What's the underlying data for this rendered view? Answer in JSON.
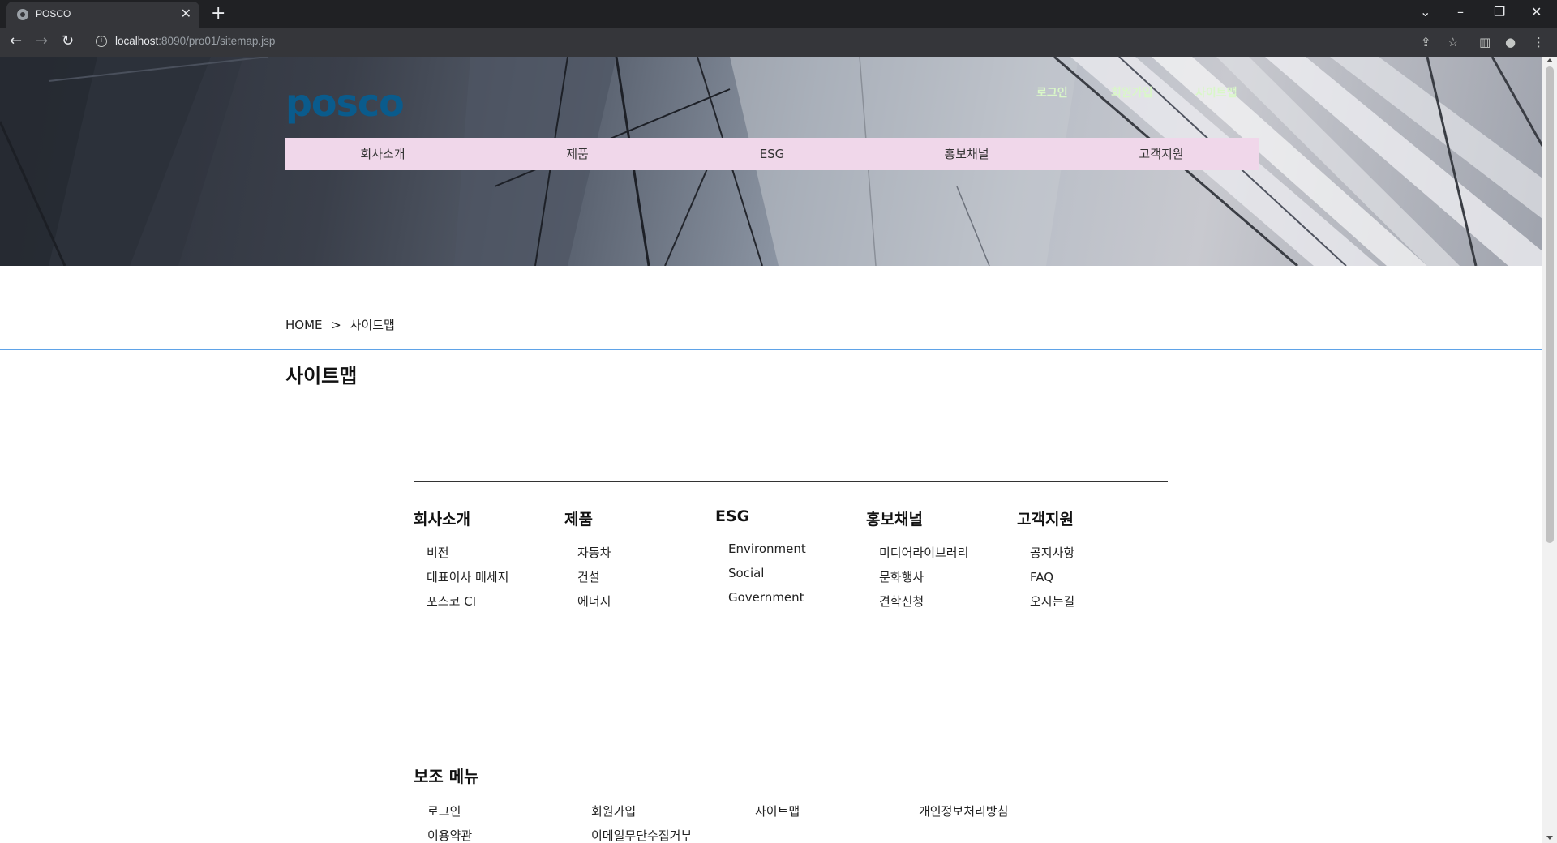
{
  "browser": {
    "tab_title": "POSCO",
    "url_host": "localhost",
    "url_path": ":8090/pro01/sitemap.jsp"
  },
  "header": {
    "logo_text": "posco",
    "util_links": [
      "로그인",
      "회원가입",
      "사이트맵"
    ],
    "gnb": [
      "회사소개",
      "제품",
      "ESG",
      "홍보채널",
      "고객지원"
    ]
  },
  "breadcrumb": {
    "home": "HOME",
    "separator": ">",
    "current": "사이트맵"
  },
  "page_title": "사이트맵",
  "sitemap": [
    {
      "title": "회사소개",
      "links": [
        "비전",
        "대표이사 메세지",
        "포스코 CI"
      ]
    },
    {
      "title": "제품",
      "links": [
        "자동차",
        "건설",
        "에너지"
      ]
    },
    {
      "title": "ESG",
      "links": [
        "Environment",
        "Social",
        "Government"
      ]
    },
    {
      "title": "홍보채널",
      "links": [
        "미디어라이브러리",
        "문화행사",
        "견학신청"
      ]
    },
    {
      "title": "고객지원",
      "links": [
        "공지사항",
        "FAQ",
        "오시는길"
      ]
    }
  ],
  "sub_menu": {
    "title": "보조 메뉴",
    "links": [
      "로그인",
      "회원가입",
      "사이트맵",
      "개인정보처리방침",
      "이용약관",
      "이메일무단수집거부"
    ]
  },
  "colors": {
    "gnb_bg": "#f0d7ea",
    "util_link": "#d9f7c8",
    "logo": "#0a5b8c",
    "accent_line": "#5fa3e8"
  }
}
